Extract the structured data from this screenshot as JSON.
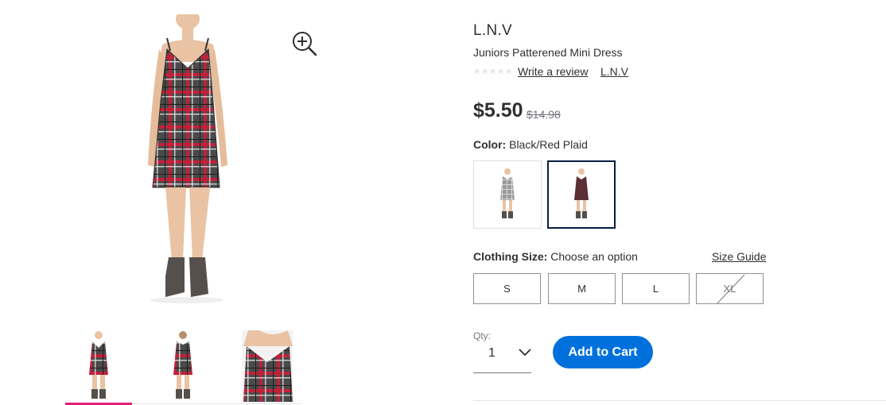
{
  "product": {
    "brand": "L.N.V",
    "title": "Juniors Patterened Mini Dress",
    "write_review_label": "Write a review",
    "brand_link_label": "L.N.V",
    "rating_stars": 0,
    "price": "$5.50",
    "was_price": "$14.98"
  },
  "gallery": {
    "main_image": "model-in-plaid-dress",
    "zoom_icon": "zoom-in-icon",
    "thumbnails": [
      "front-view",
      "back-view",
      "detail-view"
    ],
    "selected_thumbnail": 0,
    "accent_color": "#e31e76"
  },
  "color": {
    "label": "Color:",
    "value": "Black/Red Plaid",
    "swatches": [
      "grey-plaid",
      "black-red-plaid"
    ],
    "selected_swatch": 1
  },
  "size": {
    "label": "Clothing Size:",
    "value": "Choose an option",
    "guide_label": "Size Guide",
    "options": [
      {
        "label": "S",
        "available": true
      },
      {
        "label": "M",
        "available": true
      },
      {
        "label": "L",
        "available": true
      },
      {
        "label": "XL",
        "available": false
      }
    ]
  },
  "purchase": {
    "qty_label": "Qty:",
    "qty_value": "1",
    "add_to_cart_label": "Add to Cart",
    "button_color": "#0071dc"
  }
}
